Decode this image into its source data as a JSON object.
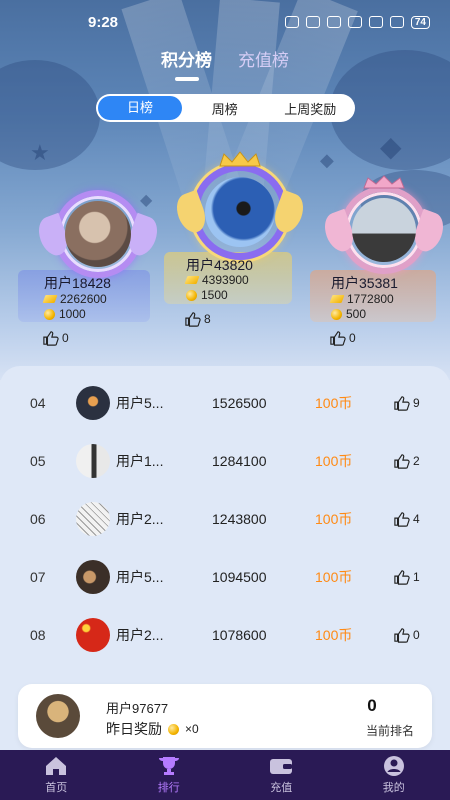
{
  "status": {
    "time": "9:28",
    "battery": "74"
  },
  "top_tabs": [
    {
      "label": "积分榜",
      "active": true
    },
    {
      "label": "充值榜",
      "active": false
    }
  ],
  "segments": [
    {
      "label": "日榜",
      "active": true
    },
    {
      "label": "周榜",
      "active": false
    },
    {
      "label": "上周奖励",
      "active": false
    }
  ],
  "podium": {
    "first": {
      "name": "用户43820",
      "points": "4393900",
      "coins": "1500",
      "likes": "8"
    },
    "second": {
      "name": "用户18428",
      "points": "2262600",
      "coins": "1000",
      "likes": "0"
    },
    "third": {
      "name": "用户35381",
      "points": "1772800",
      "coins": "500",
      "likes": "0"
    }
  },
  "ranking": [
    {
      "rank": "04",
      "name": "用户5...",
      "score": "1526500",
      "reward": "100币",
      "likes": "9"
    },
    {
      "rank": "05",
      "name": "用户1...",
      "score": "1284100",
      "reward": "100币",
      "likes": "2"
    },
    {
      "rank": "06",
      "name": "用户2...",
      "score": "1243800",
      "reward": "100币",
      "likes": "4"
    },
    {
      "rank": "07",
      "name": "用户5...",
      "score": "1094500",
      "reward": "100币",
      "likes": "1"
    },
    {
      "rank": "08",
      "name": "用户2...",
      "score": "1078600",
      "reward": "100币",
      "likes": "0"
    }
  ],
  "me": {
    "name": "用户97677",
    "reward_label": "昨日奖励",
    "reward_count": "×0",
    "rank": "0",
    "rank_label": "当前排名"
  },
  "nav": [
    {
      "label": "首页",
      "icon": "home-icon",
      "active": false
    },
    {
      "label": "排行",
      "icon": "trophy-icon",
      "active": true
    },
    {
      "label": "充值",
      "icon": "wallet-icon",
      "active": false
    },
    {
      "label": "我的",
      "icon": "profile-icon",
      "active": false
    }
  ]
}
